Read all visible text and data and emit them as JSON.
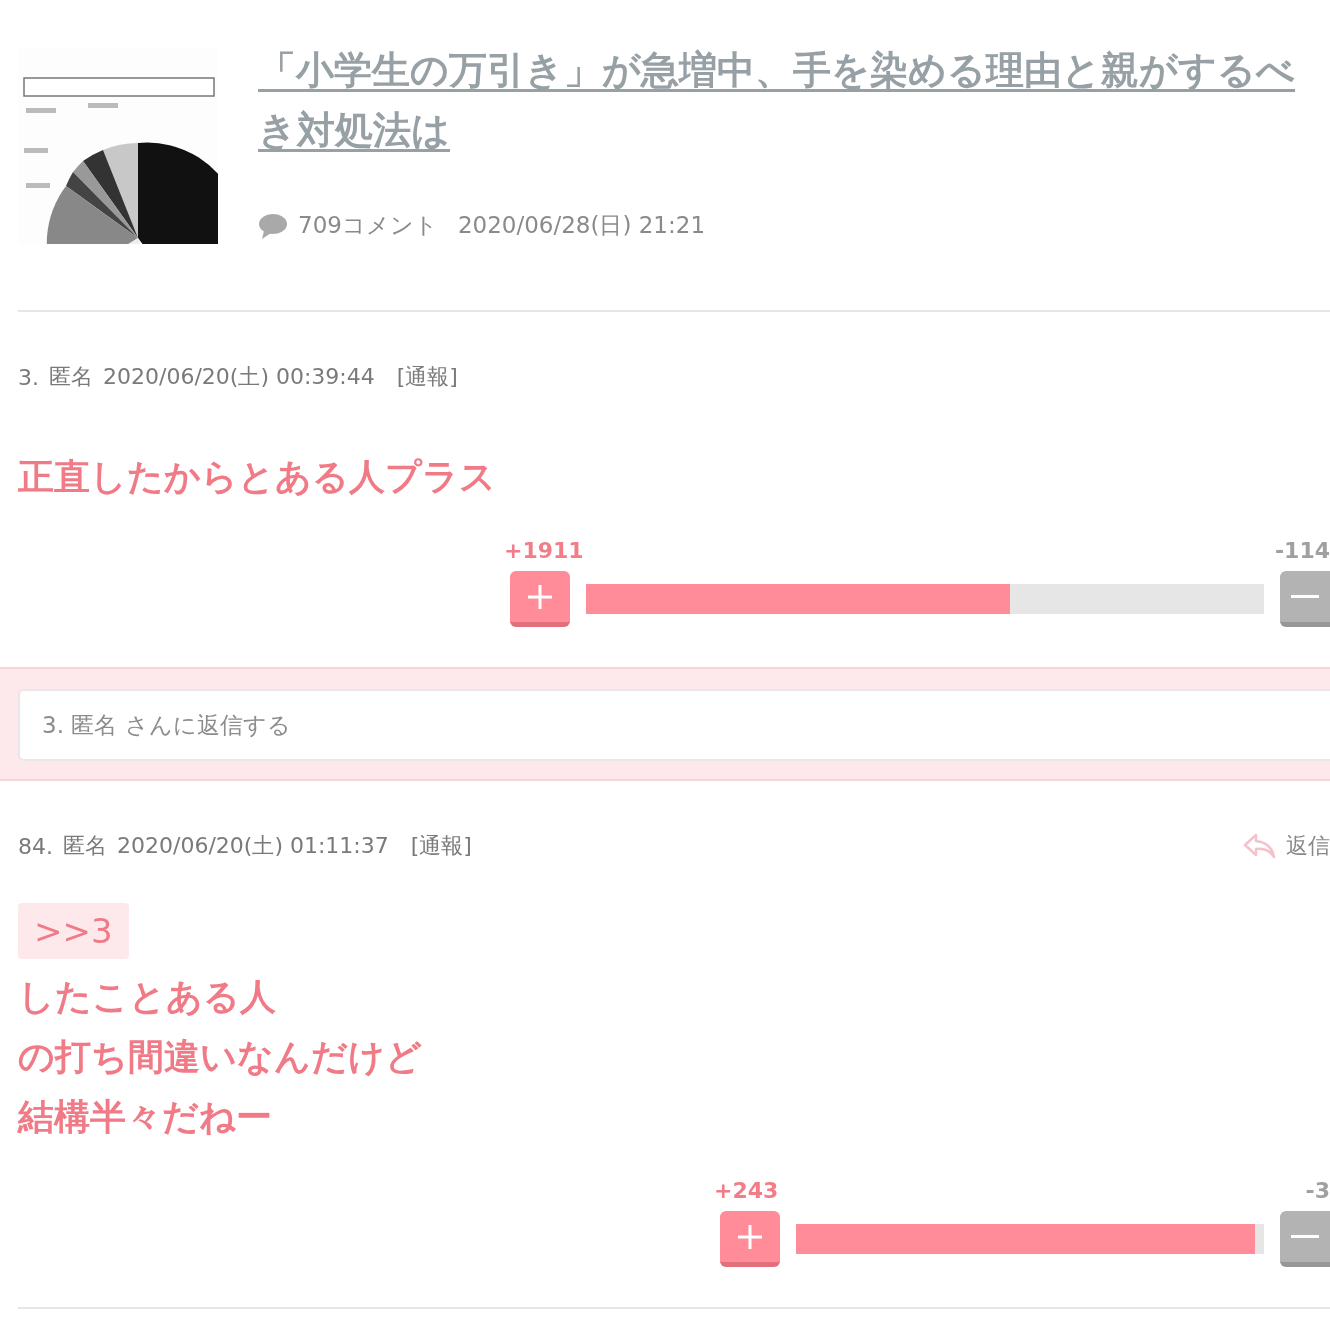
{
  "article": {
    "title": "「小学生の万引き」が急増中、手を染める理由と親がするべき対処法は",
    "comment_count": "709コメント",
    "date": "2020/06/28(日) 21:21"
  },
  "comments": [
    {
      "number": "3.",
      "author": "匿名",
      "datetime": "2020/06/20(土) 00:39:44",
      "report": "[通報]",
      "lines": [
        "正直したからとある人プラス"
      ],
      "votes": {
        "plus": "+1911",
        "minus": "-114",
        "level": 0.625
      },
      "reply_form": {
        "placeholder": "3. 匿名 さんに返信する"
      }
    },
    {
      "number": "84.",
      "author": "匿名",
      "datetime": "2020/06/20(土) 01:11:37",
      "report": "[通報]",
      "reply_label": "返信",
      "anchor": ">>3",
      "lines": [
        "したことある人",
        "の打ち間違いなんだけど",
        "結構半々だねー"
      ],
      "votes": {
        "plus": "+243",
        "minus": "-3",
        "level": 0.98
      }
    }
  ]
}
